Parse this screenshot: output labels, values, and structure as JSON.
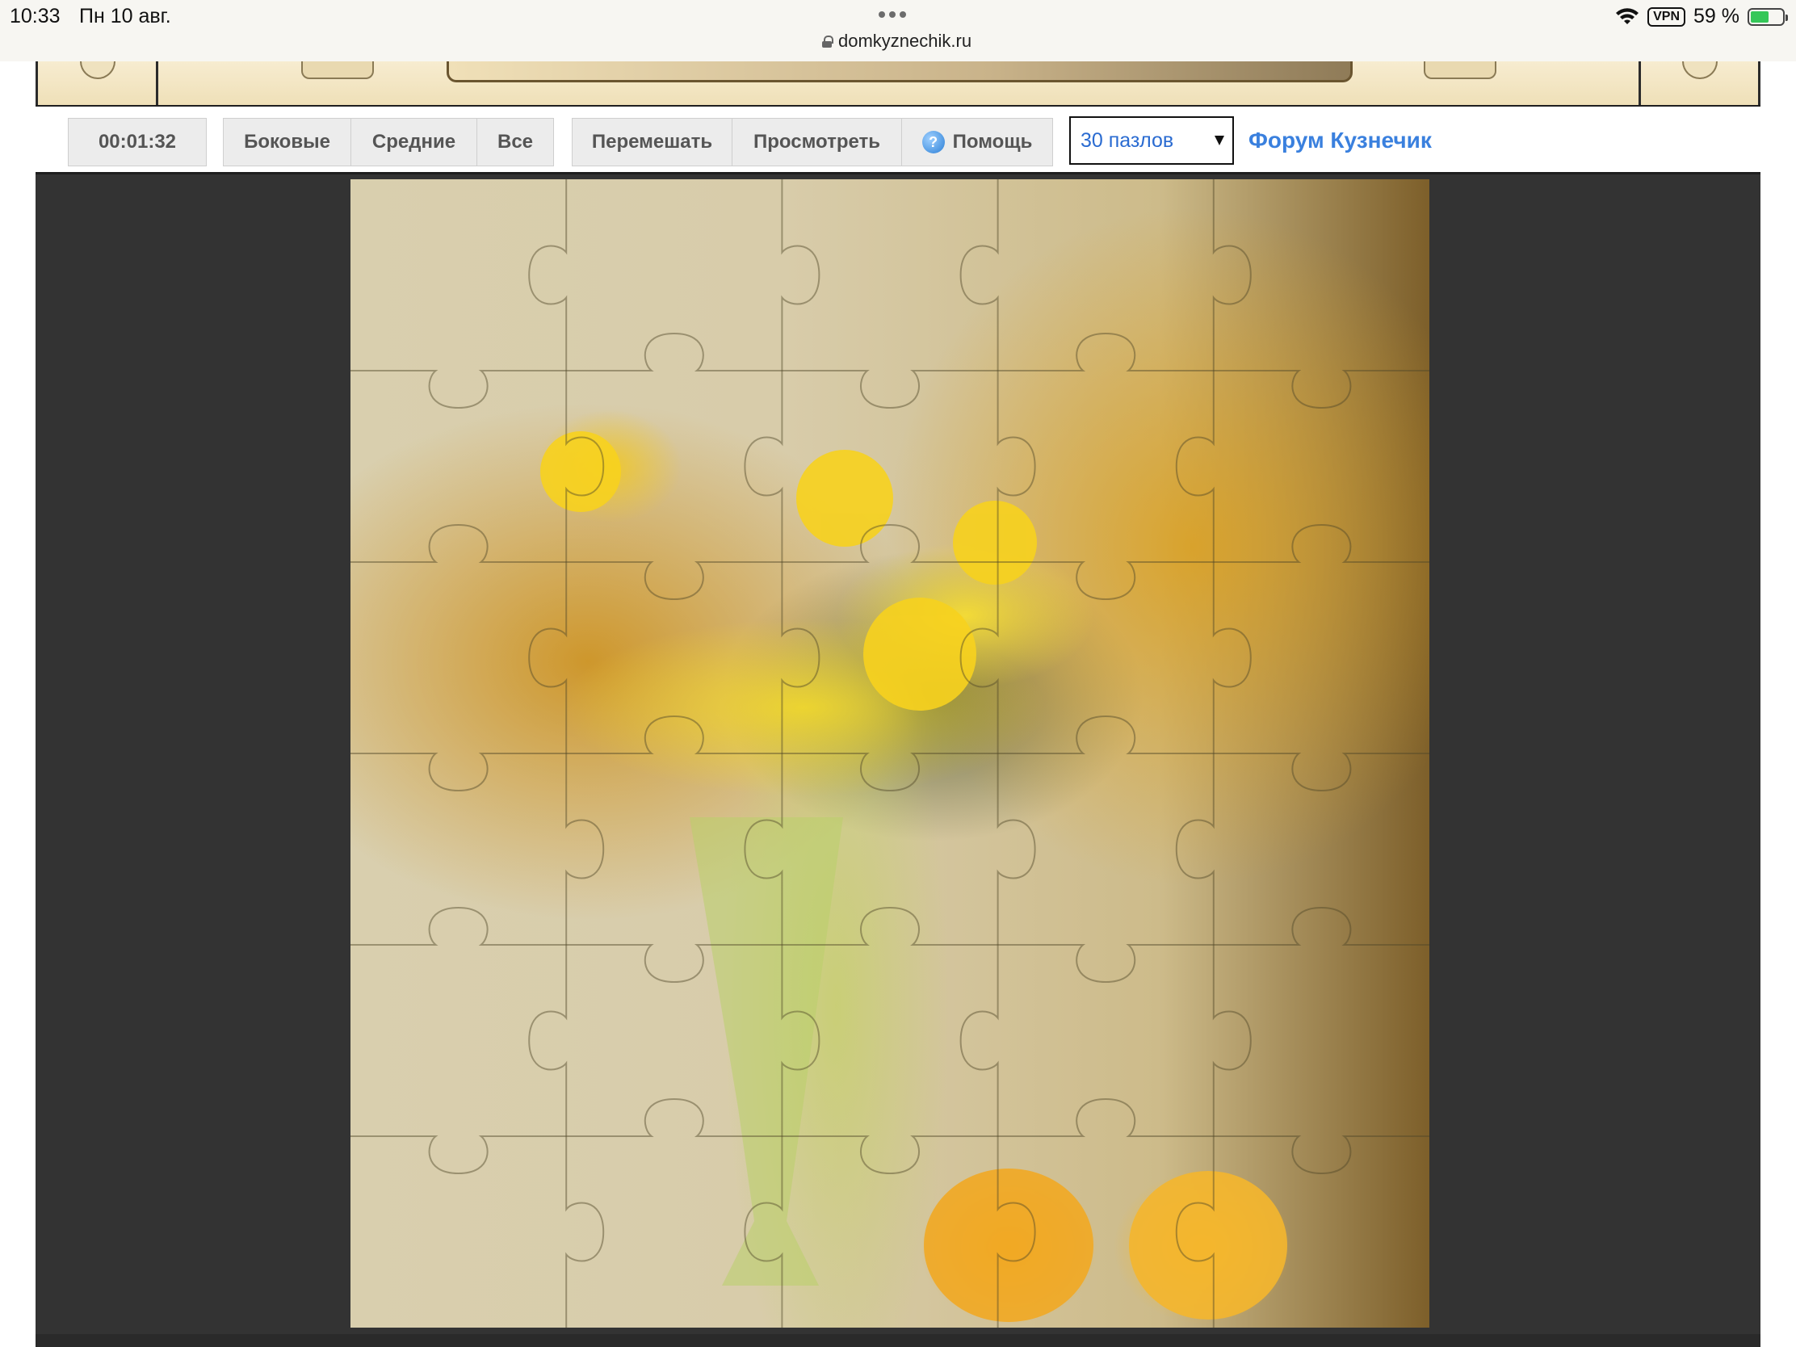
{
  "status_bar": {
    "time": "10:33",
    "date": "Пн 10 авг.",
    "url": "domkyznechik.ru",
    "vpn": "VPN",
    "battery": "59 %",
    "battery_level_percent": 59
  },
  "toolbar": {
    "timer": "00:01:32",
    "filter_buttons": [
      "Боковые",
      "Средние",
      "Все"
    ],
    "action_buttons": {
      "shuffle": "Перемешать",
      "preview": "Просмотреть",
      "help": "Помощь"
    },
    "pieces_select": {
      "selected": "30 пазлов"
    },
    "forum_link": "Форум Кузнечик"
  },
  "puzzle": {
    "columns": 5,
    "rows": 6,
    "pieces": 30,
    "picture_subject": "yellow daffodils and mimosa in a crystal vase with two lemons"
  },
  "colors": {
    "board_background": "#333333",
    "link_color": "#3a80de",
    "select_text": "#2a6bd1"
  }
}
